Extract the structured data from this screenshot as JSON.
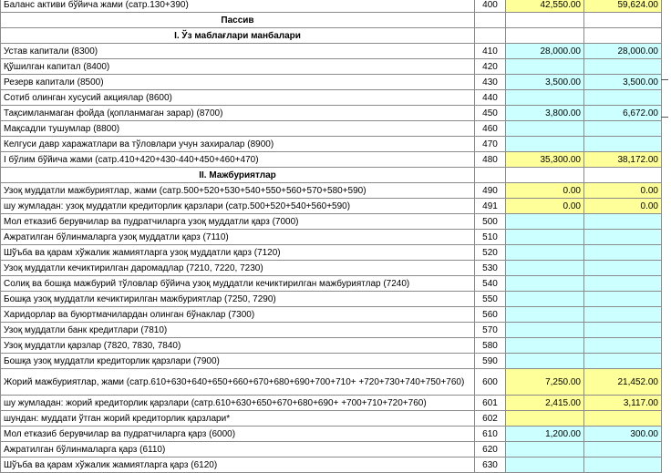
{
  "colors": {
    "yellow_cell": "#ffff99",
    "cyan_cell": "#ccffff",
    "grid": "#8a8a8a"
  },
  "rows": [
    {
      "kind": "data",
      "label": "Баланс активи бўйича жами (сатр.130+390)",
      "code": "400",
      "v1": "42,550.00",
      "v2": "59,624.00",
      "fill": "y"
    },
    {
      "kind": "header",
      "label": "Пассив"
    },
    {
      "kind": "header",
      "label": "I. Ўз маблағлари манбалари"
    },
    {
      "kind": "data",
      "label": "Устав капитали (8300)",
      "code": "410",
      "v1": "28,000.00",
      "v2": "28,000.00",
      "fill": "c"
    },
    {
      "kind": "data",
      "label": "Қўшилган капитал (8400)",
      "code": "420",
      "v1": "",
      "v2": "",
      "fill": "c"
    },
    {
      "kind": "data",
      "label": "Резерв капитали (8500)",
      "code": "430",
      "v1": "3,500.00",
      "v2": "3,500.00",
      "fill": "c"
    },
    {
      "kind": "data",
      "label": "Сотиб олинган хусусий акциялар (8600)",
      "code": "440",
      "v1": "",
      "v2": "",
      "fill": "c"
    },
    {
      "kind": "data",
      "label": "Тақсимланмаган фойда (қопланмаган зарар) (8700)",
      "code": "450",
      "v1": "3,800.00",
      "v2": "6,672.00",
      "fill": "c"
    },
    {
      "kind": "data",
      "label": "Мақсадли тушумлар (8800)",
      "code": "460",
      "v1": "",
      "v2": "",
      "fill": "c"
    },
    {
      "kind": "data",
      "label": "Келгуси давр харажатлари ва тўловлари учун захиралар (8900)",
      "code": "470",
      "v1": "",
      "v2": "",
      "fill": "c"
    },
    {
      "kind": "data",
      "label": "I бўлим бўйича жами (сатр.410+420+430-440+450+460+470)",
      "code": "480",
      "v1": "35,300.00",
      "v2": "38,172.00",
      "fill": "y"
    },
    {
      "kind": "header",
      "label": "II. Мажбуриятлар"
    },
    {
      "kind": "data",
      "label": "Узоқ муддатли мажбуриятлар, жами (сатр.500+520+530+540+550+560+570+580+590)",
      "code": "490",
      "v1": "0.00",
      "v2": "0.00",
      "fill": "y"
    },
    {
      "kind": "data",
      "label": "шу жумладан: узоқ муддатли кредиторлик қарзлари (сатр.500+520+540+560+590)",
      "code": "491",
      "v1": "0.00",
      "v2": "0.00",
      "fill": "y"
    },
    {
      "kind": "data",
      "label": "Мол етказиб берувчилар ва пудратчиларга узоқ муддатли қарз (7000)",
      "code": "500",
      "v1": "",
      "v2": "",
      "fill": "c"
    },
    {
      "kind": "data",
      "label": "Ажратилган бўлинмаларга узоқ муддатли қарз (7110)",
      "code": "510",
      "v1": "",
      "v2": "",
      "fill": "c"
    },
    {
      "kind": "data",
      "label": "Шўъба ва қарам хўжалик жамиятларга узоқ муддатли қарз (7120)",
      "code": "520",
      "v1": "",
      "v2": "",
      "fill": "c"
    },
    {
      "kind": "data",
      "label": "Узоқ муддатли кечиктирилган даромадлар (7210, 7220, 7230)",
      "code": "530",
      "v1": "",
      "v2": "",
      "fill": "c"
    },
    {
      "kind": "data",
      "label": "Солиқ ва бошқа мажбурий тўловлар бўйича узоқ муддатли кечиктирилган мажбуриятлар (7240)",
      "code": "540",
      "v1": "",
      "v2": "",
      "fill": "c"
    },
    {
      "kind": "data",
      "label": "Бошқа узоқ муддатли кечиктирилган мажбуриятлар (7250, 7290)",
      "code": "550",
      "v1": "",
      "v2": "",
      "fill": "c"
    },
    {
      "kind": "data",
      "label": "Харидорлар ва буюртмачилардан олинган бўнаклар (7300)",
      "code": "560",
      "v1": "",
      "v2": "",
      "fill": "c"
    },
    {
      "kind": "data",
      "label": "Узоқ муддатли банк кредитлари (7810)",
      "code": "570",
      "v1": "",
      "v2": "",
      "fill": "c"
    },
    {
      "kind": "data",
      "label": "Узоқ муддатли қарзлар (7820, 7830, 7840)",
      "code": "580",
      "v1": "",
      "v2": "",
      "fill": "c"
    },
    {
      "kind": "data",
      "label": "Бошқа узоқ муддатли кредиторлик қарзлари (7900)",
      "code": "590",
      "v1": "",
      "v2": "",
      "fill": "c"
    },
    {
      "kind": "data",
      "tall": true,
      "label": "Жорий мажбуриятлар, жами (сатр.610+630+640+650+660+670+680+690+700+710+ +720+730+740+750+760)",
      "code": "600",
      "v1": "7,250.00",
      "v2": "21,452.00",
      "fill": "y"
    },
    {
      "kind": "data",
      "label": "шу жумладан: жорий кредиторлик қарзлари (сатр.610+630+650+670+680+690+ +700+710+720+760)",
      "code": "601",
      "v1": "2,415.00",
      "v2": "3,117.00",
      "fill": "y"
    },
    {
      "kind": "data",
      "label": "шундан: муддати ўтган жорий кредиторлик қарзлари*",
      "code": "602",
      "v1": "",
      "v2": "",
      "fill": "y"
    },
    {
      "kind": "data",
      "label": "Мол етказиб берувчилар ва пудратчиларга қарз (6000)",
      "code": "610",
      "v1": "1,200.00",
      "v2": "300.00",
      "fill": "c"
    },
    {
      "kind": "data",
      "label": "Ажратилган бўлинмаларга қарз (6110)",
      "code": "620",
      "v1": "",
      "v2": "",
      "fill": "c"
    },
    {
      "kind": "data",
      "label": "Шўъба ва қарам хўжалик жамиятларга қарз (6120)",
      "code": "630",
      "v1": "",
      "v2": "",
      "fill": "c"
    }
  ]
}
